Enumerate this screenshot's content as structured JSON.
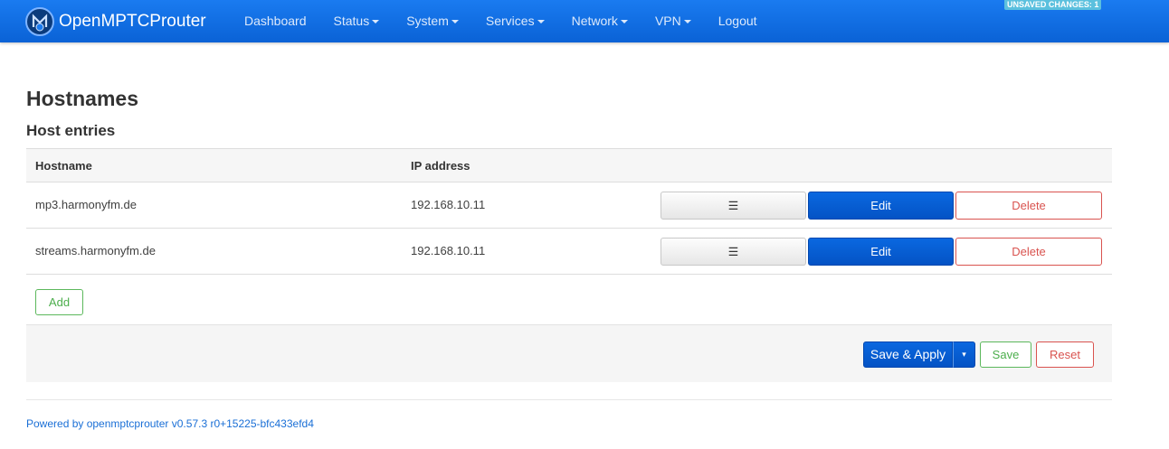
{
  "navbar": {
    "brand": "OpenMPTCProuter",
    "items": [
      {
        "label": "Dashboard",
        "dropdown": false
      },
      {
        "label": "Status",
        "dropdown": true
      },
      {
        "label": "System",
        "dropdown": true
      },
      {
        "label": "Services",
        "dropdown": true
      },
      {
        "label": "Network",
        "dropdown": true
      },
      {
        "label": "VPN",
        "dropdown": true
      },
      {
        "label": "Logout",
        "dropdown": false
      }
    ],
    "unsaved_changes": "UNSAVED CHANGES: 1"
  },
  "page": {
    "title": "Hostnames",
    "section_title": "Host entries"
  },
  "table": {
    "headers": [
      "Hostname",
      "IP address"
    ],
    "rows": [
      {
        "hostname": "mp3.harmonyfm.de",
        "ip": "192.168.10.11"
      },
      {
        "hostname": "streams.harmonyfm.de",
        "ip": "192.168.10.11"
      }
    ],
    "sort_label": "☰",
    "edit_label": "Edit",
    "delete_label": "Delete"
  },
  "add_label": "Add",
  "actions": {
    "save_apply_label": "Save & Apply",
    "save_apply_dropdown": "▾",
    "save_label": "Save",
    "reset_label": "Reset"
  },
  "footer": "Powered by openmptcprouter v0.57.3 r0+15225-bfc433efd4",
  "colors": {
    "navbar": "#0a68e0",
    "primary": "#0453c5",
    "success": "#5cb85c",
    "danger": "#d9534f",
    "info": "#5bc0de",
    "link": "#1a6fd6"
  }
}
